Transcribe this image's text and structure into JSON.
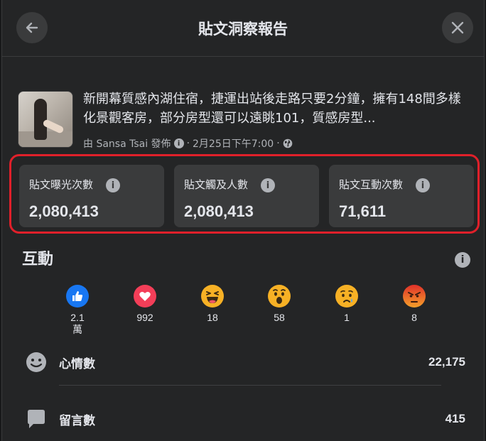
{
  "header": {
    "title": "貼文洞察報告"
  },
  "post": {
    "text": "新開幕質感內湖住宿，捷運出站後走路只要2分鐘，擁有148間多樣化景觀客房，部分房型還可以遠眺101，質感房型...",
    "author_line": "由 Sansa Tsai 發佈",
    "date": "2月25日下午7:00",
    "separator": "·"
  },
  "stats": [
    {
      "label": "貼文曝光次數",
      "value": "2,080,413"
    },
    {
      "label": "貼文觸及人數",
      "value": "2,080,413"
    },
    {
      "label": "貼文互動次數",
      "value": "71,611"
    }
  ],
  "engagement": {
    "title": "互動",
    "reactions": [
      {
        "icon": "like-icon",
        "count": "2.1\n萬",
        "color": "#1877f2"
      },
      {
        "icon": "love-icon",
        "count": "992",
        "color": "#f33e58"
      },
      {
        "icon": "haha-icon",
        "count": "18",
        "color": "#f7b125"
      },
      {
        "icon": "wow-icon",
        "count": "58",
        "color": "#f7b125"
      },
      {
        "icon": "sad-icon",
        "count": "1",
        "color": "#f7b125"
      },
      {
        "icon": "angry-icon",
        "count": "8",
        "color": "#e9710f"
      }
    ],
    "rows": [
      {
        "icon": "smiley-icon",
        "label": "心情數",
        "value": "22,175"
      },
      {
        "icon": "comment-icon",
        "label": "留言數",
        "value": "415"
      }
    ]
  },
  "info_glyph": "i"
}
